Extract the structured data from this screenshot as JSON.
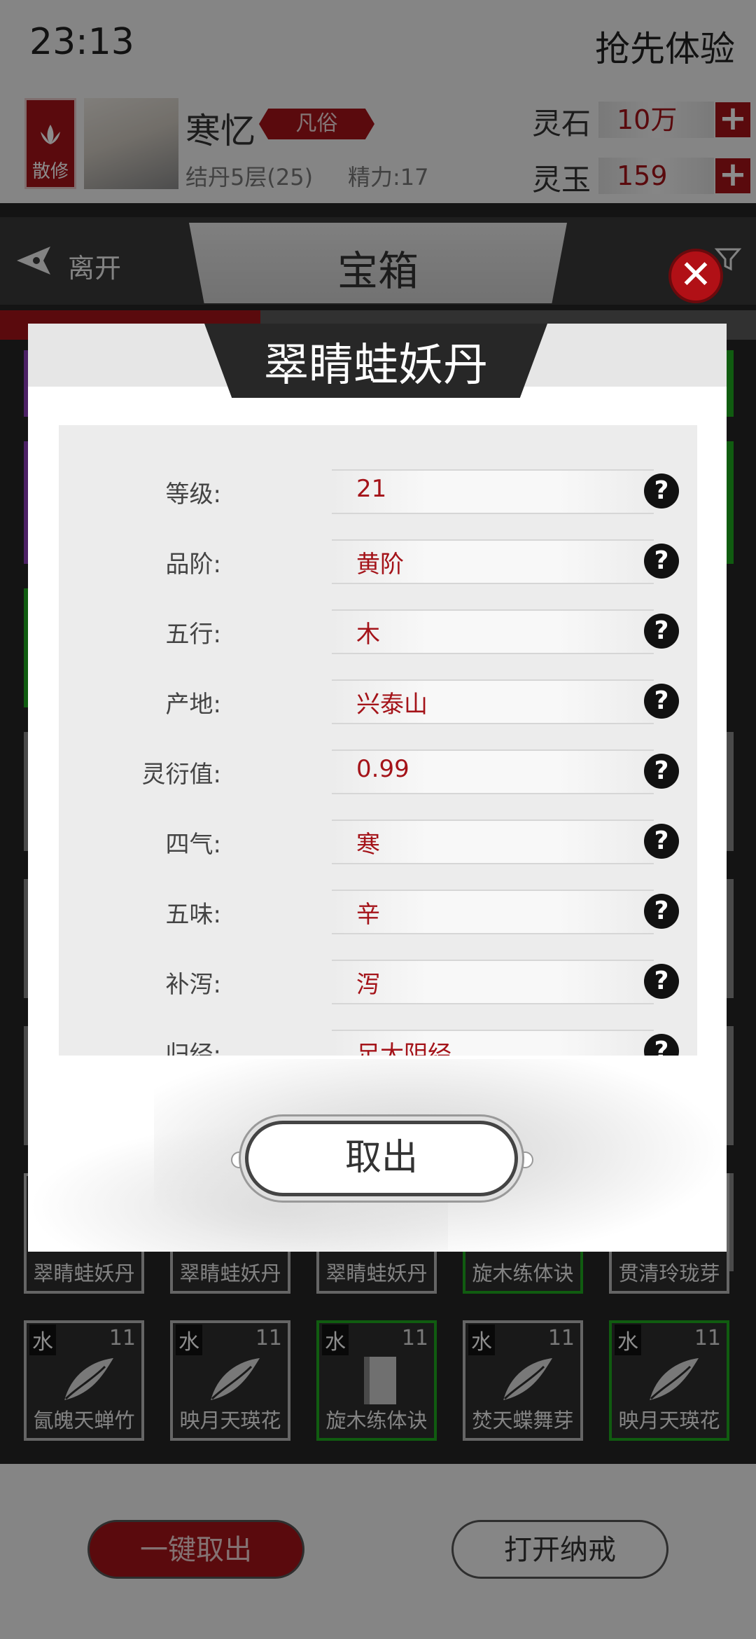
{
  "status": {
    "time": "23:13",
    "early_access": "抢先体验"
  },
  "player": {
    "sect": "散修",
    "name": "寒忆",
    "rank": "凡俗",
    "realm": "结丹5层(25)",
    "energy": "精力:17",
    "resources": [
      {
        "label": "灵石",
        "value": "10万"
      },
      {
        "label": "灵玉",
        "value": "159"
      }
    ]
  },
  "nav": {
    "leave": "离开",
    "title": "宝箱"
  },
  "grid": {
    "row_names": [
      "翠睛蛙妖丹",
      "翠睛蛙妖丹",
      "翠睛蛙妖丹",
      "旋木练体诀",
      "贯清玲珑芽"
    ],
    "slots": [
      {
        "element": "水",
        "level": "11",
        "name": "氤魄天蝉竹",
        "icon": "leaf-icon"
      },
      {
        "element": "水",
        "level": "11",
        "name": "映月天瑛花",
        "icon": "leaf-icon"
      },
      {
        "element": "水",
        "level": "11",
        "name": "旋木练体诀",
        "icon": "scroll-icon"
      },
      {
        "element": "水",
        "level": "11",
        "name": "焚天蝶舞芽",
        "icon": "leaf-icon"
      },
      {
        "element": "水",
        "level": "11",
        "name": "映月天瑛花",
        "icon": "leaf-icon"
      }
    ]
  },
  "bottom": {
    "take_all": "一键取出",
    "open_ring": "打开纳戒"
  },
  "modal": {
    "title": "翠睛蛙妖丹",
    "properties": [
      {
        "label": "等级:",
        "value": "21"
      },
      {
        "label": "品阶:",
        "value": "黄阶"
      },
      {
        "label": "五行:",
        "value": "木"
      },
      {
        "label": "产地:",
        "value": "兴泰山"
      },
      {
        "label": "灵衍值:",
        "value": "0.99"
      },
      {
        "label": "四气:",
        "value": "寒"
      },
      {
        "label": "五味:",
        "value": "辛"
      },
      {
        "label": "补泻:",
        "value": "泻"
      },
      {
        "label": "归经:",
        "value": "足太阴经"
      }
    ],
    "help_glyph": "?",
    "take_out": "取出",
    "close_glyph": "✕"
  },
  "colors": {
    "accent_red": "#a41319",
    "rarity_green": "#1ea81e",
    "rarity_purple": "#8a3cb8"
  }
}
